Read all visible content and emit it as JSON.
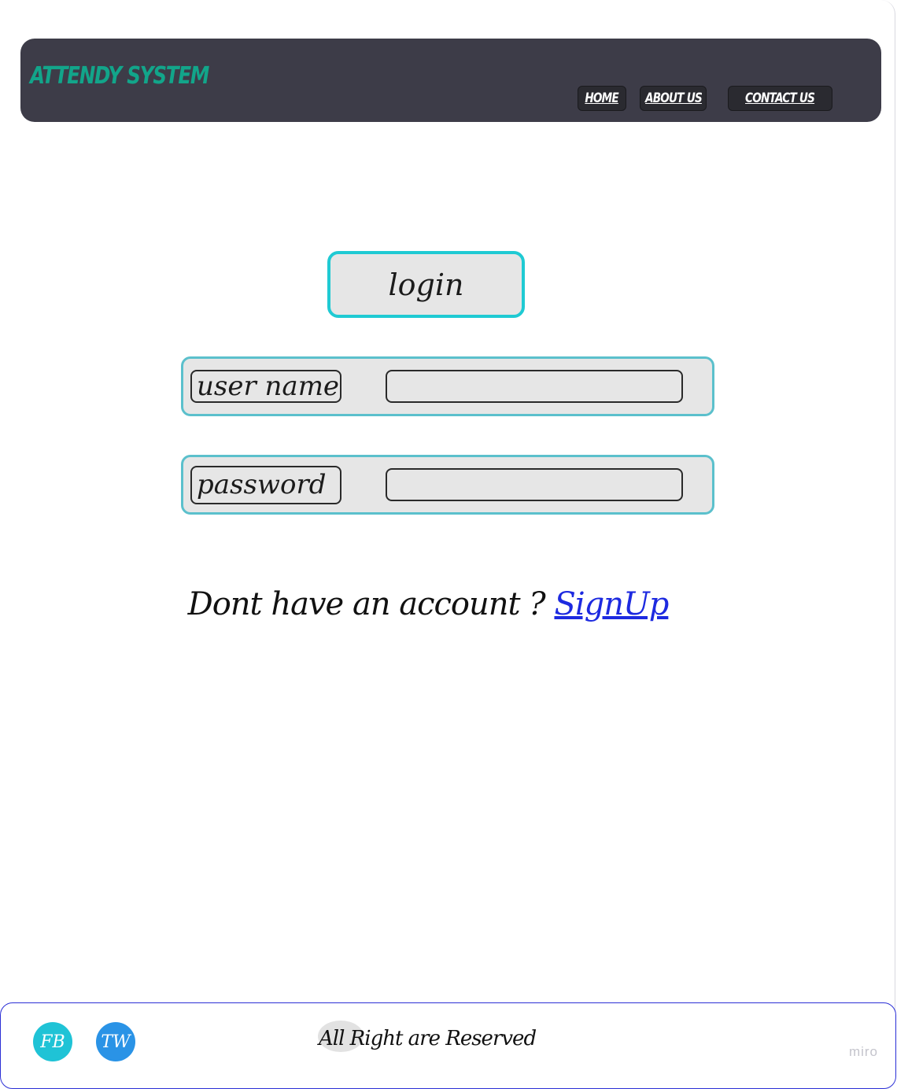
{
  "header": {
    "brand": "ATTENDY SYSTEM",
    "nav": [
      {
        "label": "HOME"
      },
      {
        "label": "ABOUT US"
      },
      {
        "label": "CONTACT US"
      }
    ]
  },
  "login": {
    "title": "login",
    "fields": {
      "username_label": "user name",
      "username_value": "",
      "password_label": "password",
      "password_value": ""
    },
    "signup_prompt": "Dont have an account ? ",
    "signup_link": "SignUp"
  },
  "footer": {
    "social": [
      {
        "label": "FB",
        "icon": "facebook-icon",
        "color": "#1fc3d6"
      },
      {
        "label": "TW",
        "icon": "twitter-icon",
        "color": "#2a93e6"
      }
    ],
    "copyright": "All Right are Reserved",
    "watermark": "miro"
  },
  "colors": {
    "header_bg": "#3d3c48",
    "brand": "#12a58a",
    "login_border": "#1fcad3",
    "row_border": "#5bc0cc",
    "link": "#1d2ae0",
    "footer_border": "#2b2fd6"
  }
}
